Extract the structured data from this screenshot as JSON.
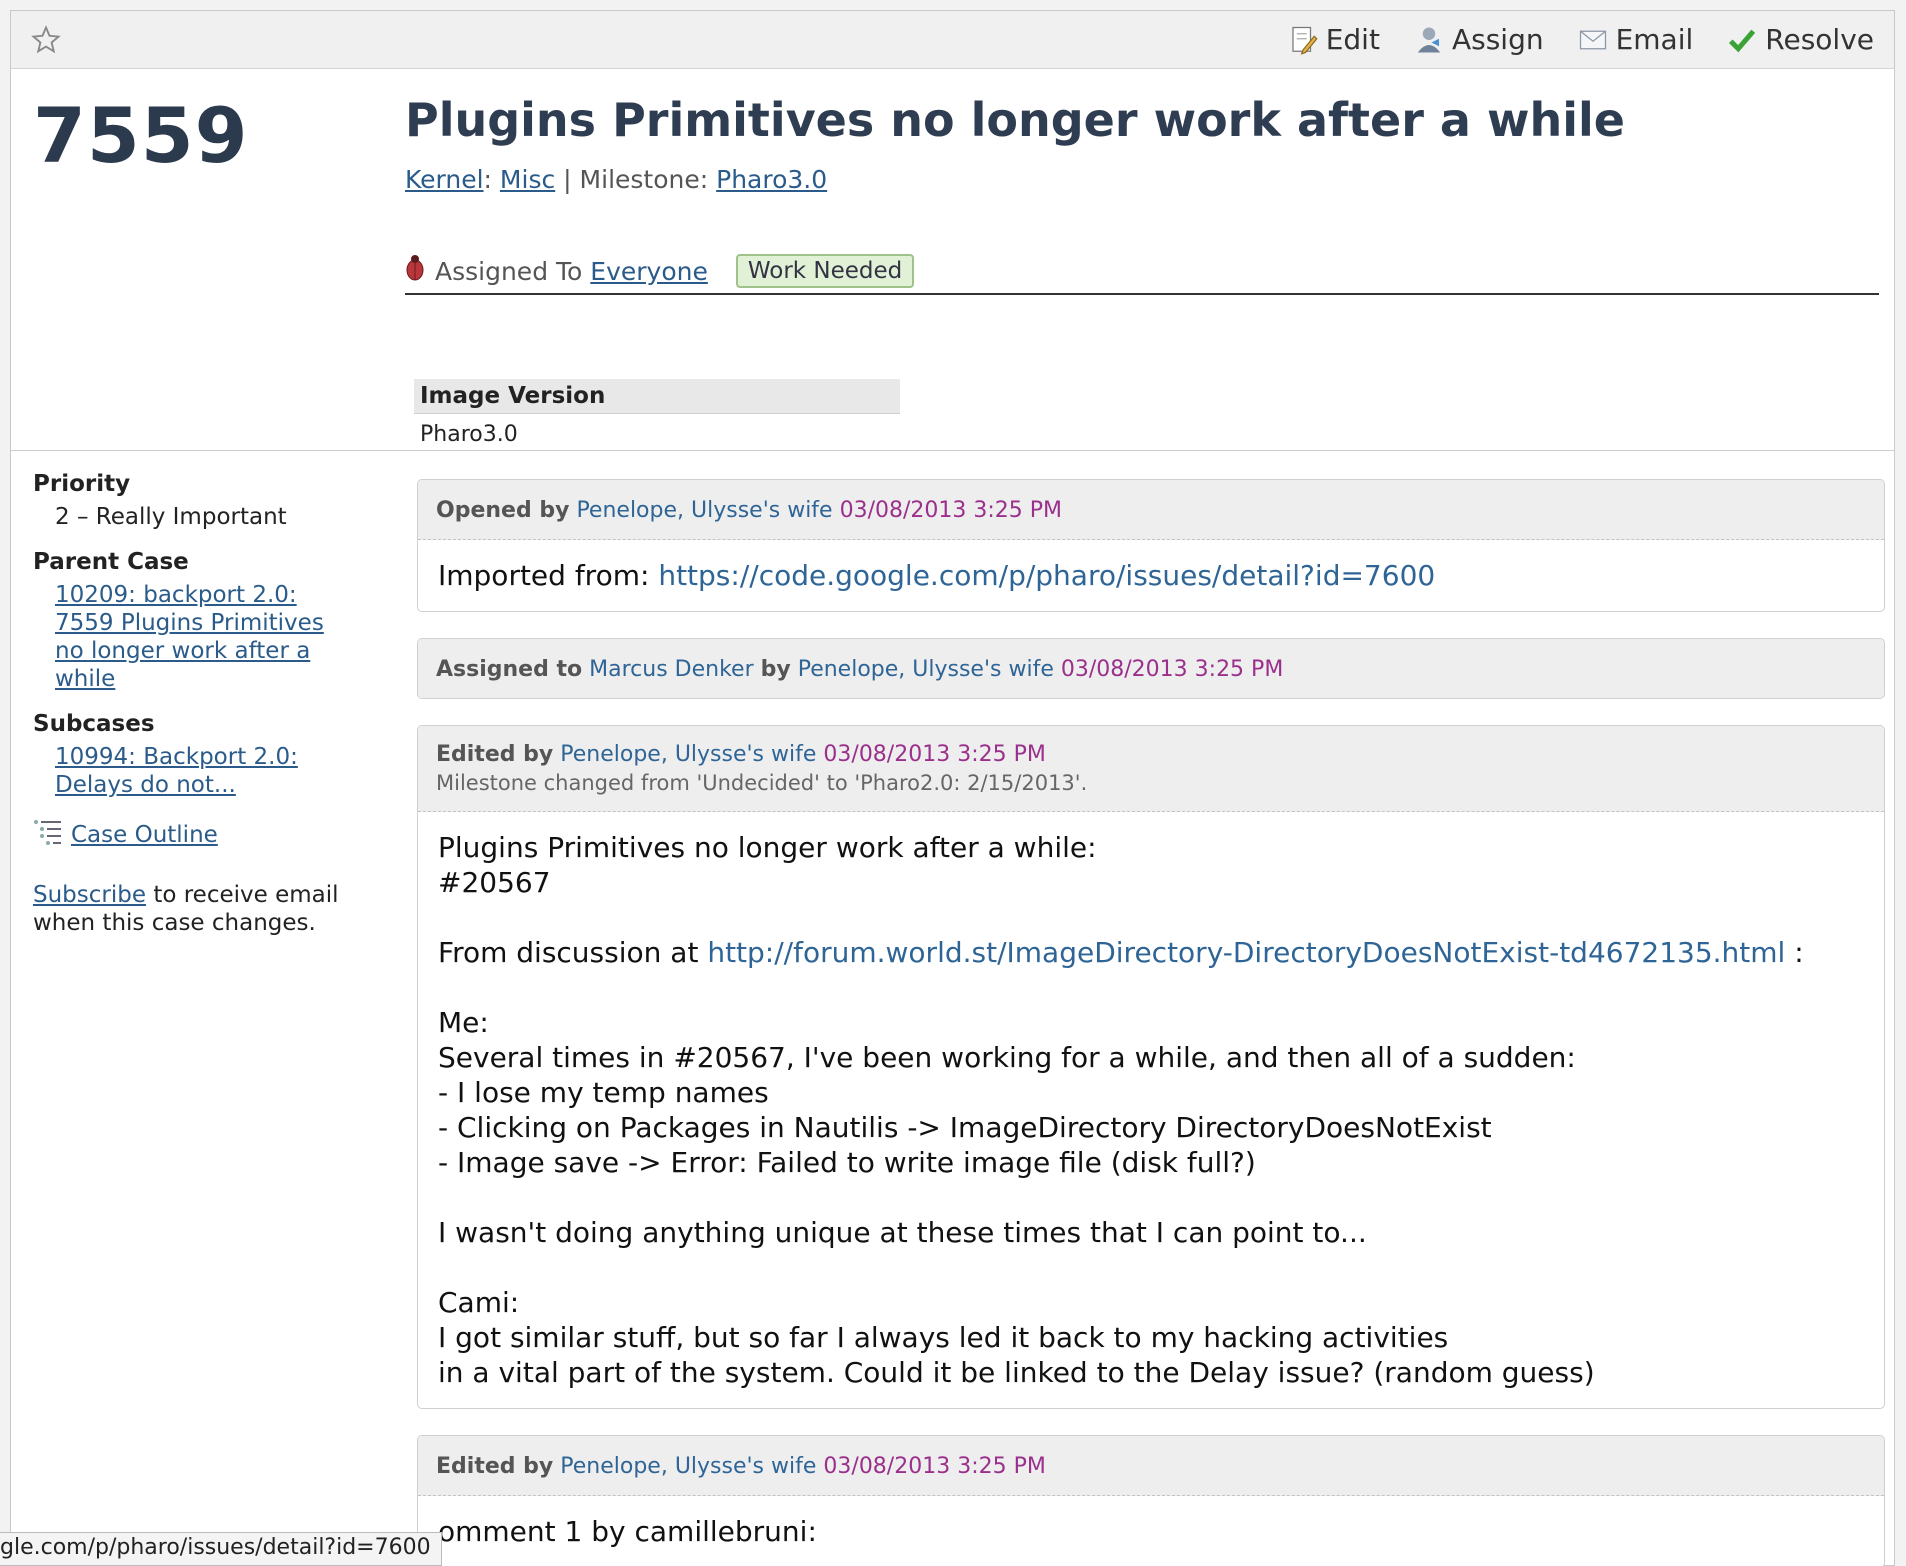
{
  "toolbar": {
    "actions": [
      {
        "label": "Edit",
        "icon": "edit-icon"
      },
      {
        "label": "Assign",
        "icon": "assign-icon"
      },
      {
        "label": "Email",
        "icon": "email-icon"
      },
      {
        "label": "Resolve",
        "icon": "checkmark-icon"
      }
    ]
  },
  "case": {
    "number": "7559",
    "title": "Plugins Primitives no longer work after a while",
    "project": "Kernel",
    "area": "Misc",
    "milestone_label": "Milestone:",
    "milestone": "Pharo3.0",
    "assigned_label": "Assigned To",
    "assigned_to": "Everyone",
    "status": "Work Needed",
    "image_version_label": "Image Version",
    "image_version": "Pharo3.0"
  },
  "sidebar": {
    "priority_label": "Priority",
    "priority": "2 – Really Important",
    "parent_label": "Parent Case",
    "parent_lines": [
      "10209: backport 2.0:",
      "7559 Plugins Primitives",
      "no longer work after a",
      "while"
    ],
    "subcases_label": "Subcases",
    "subcase_lines": [
      "10994: Backport 2.0:",
      "Delays do not..."
    ],
    "outline": "Case Outline",
    "subscribe_link": "Subscribe",
    "subscribe_rest": " to receive email",
    "subscribe_line2": "when this case changes."
  },
  "events": {
    "e1": {
      "verb": "Opened by",
      "person": "Penelope, Ulysse's wife",
      "date": "03/08/2013 3:25 PM",
      "body_prefix": "Imported from: ",
      "body_link": "https://code.google.com/p/pharo/issues/detail?id=7600"
    },
    "e2": {
      "verb": "Assigned to",
      "assignee": "Marcus Denker",
      "by": "by",
      "person": "Penelope, Ulysse's wife",
      "date": "03/08/2013 3:25 PM"
    },
    "e3": {
      "verb": "Edited by",
      "person": "Penelope, Ulysse's wife",
      "date": "03/08/2013 3:25 PM",
      "change": "Milestone changed from 'Undecided' to 'Pharo2.0: 2/15/2013'.",
      "line1": "Plugins Primitives no longer work after a while:",
      "line2": "#20567",
      "line3_prefix": "From discussion at ",
      "line3_link": "http://forum.world.st/ImageDirectory-DirectoryDoesNotExist-td4672135.html",
      "line3_suffix": " :",
      "line4": "Me:",
      "line5": "Several times in #20567, I've been working for a while, and then all of a sudden:",
      "line6": "- I lose my temp names",
      "line7": "- Clicking on Packages in Nautilis -> ImageDirectory DirectoryDoesNotExist",
      "line8": "- Image save -> Error: Failed to write image file (disk full?)",
      "line9": "I wasn't doing anything unique at these times that I can point to...",
      "line10": "Cami:",
      "line11": "I got similar stuff, but so far I always led it back to my hacking activities",
      "line12": "in a vital part of the system. Could it be linked to the Delay issue? (random guess)"
    },
    "e4": {
      "verb": "Edited by",
      "person": "Penelope, Ulysse's wife",
      "date": "03/08/2013 3:25 PM",
      "body_partial": "omment 1 by camillebruni:"
    }
  },
  "statusbar": "gle.com/p/pharo/issues/detail?id=7600",
  "colors": {
    "accent_link": "#2a5b8a",
    "date": "#9b2f8c",
    "title": "#2f3d52",
    "status_badge_bg": "#e1f1d6"
  }
}
